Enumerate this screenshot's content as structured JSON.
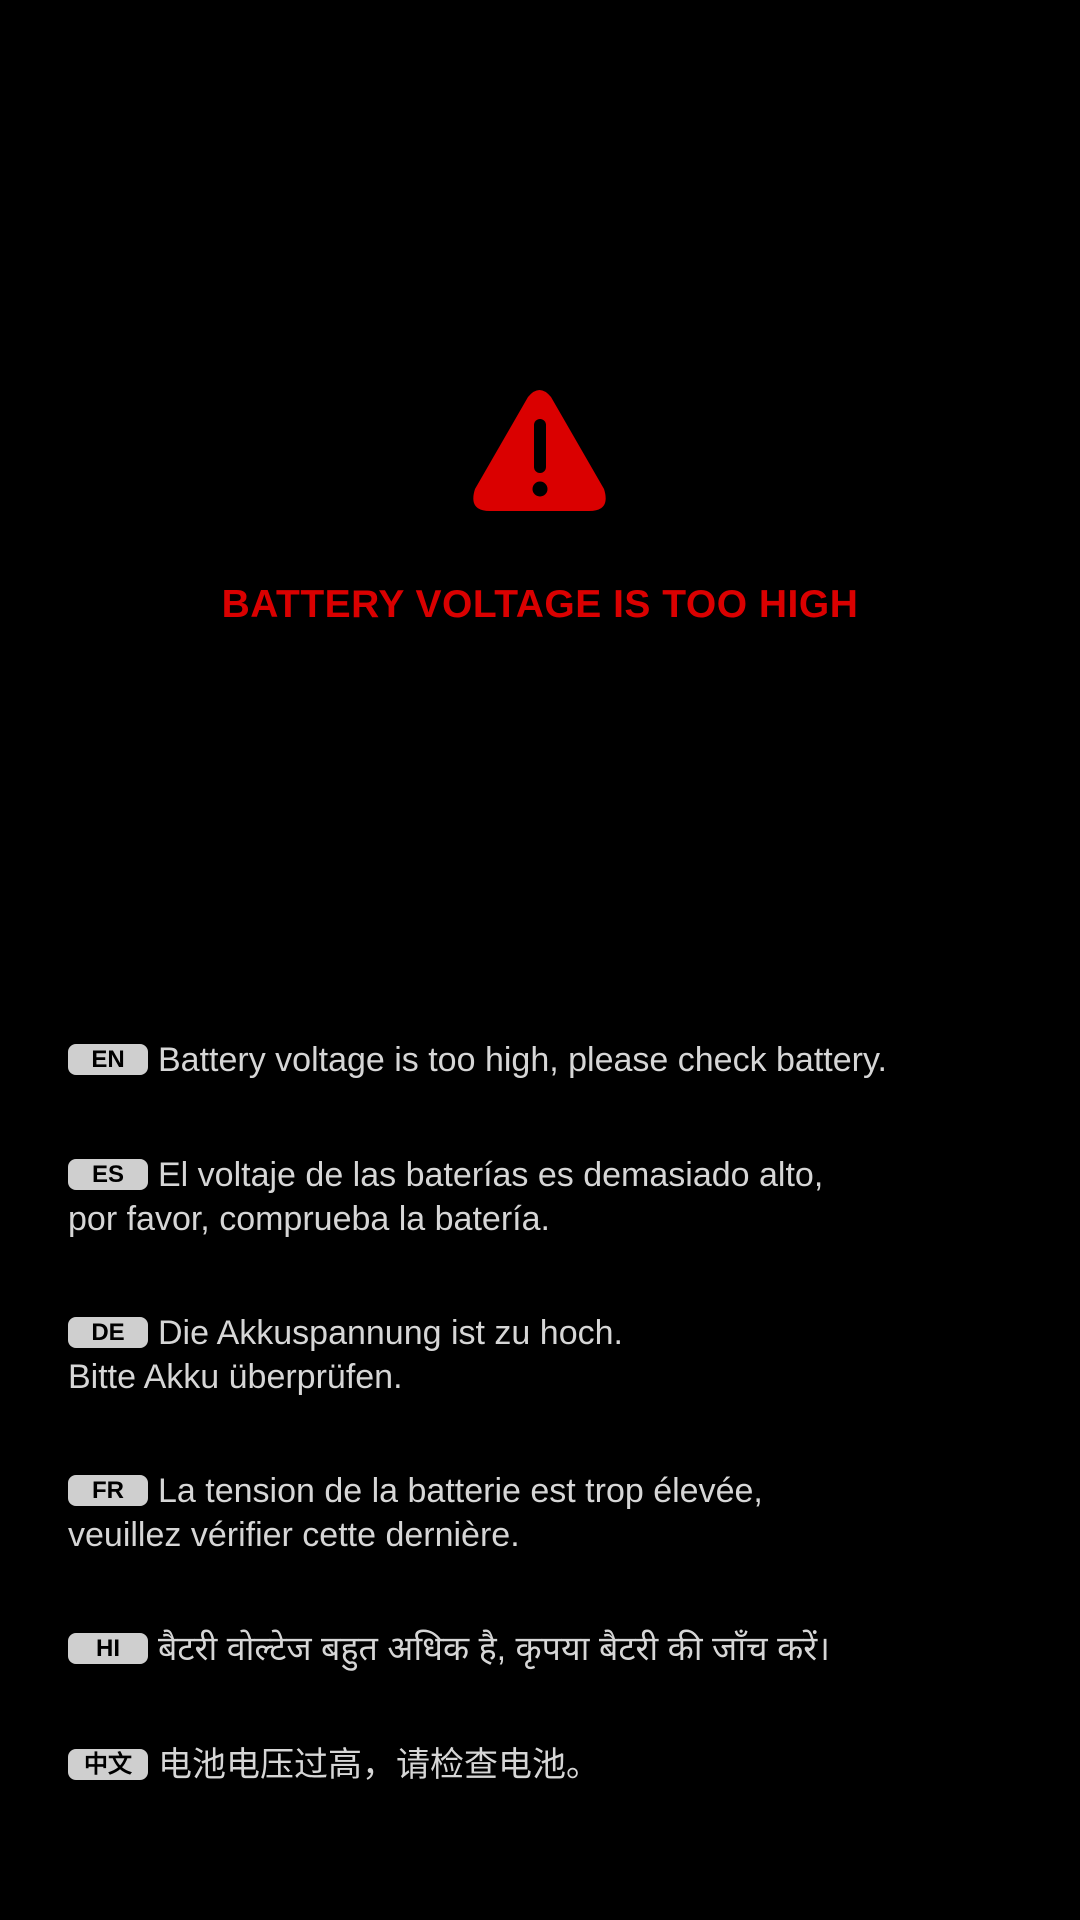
{
  "colors": {
    "background": "#000000",
    "alert_red": "#DA0000",
    "text_gray": "#D6D6D6",
    "badge_bg": "#CFCFCF",
    "badge_text": "#000000"
  },
  "icon": {
    "name": "warning-triangle-icon"
  },
  "alert": {
    "title": "BATTERY VOLTAGE IS TOO HIGH"
  },
  "messages": [
    {
      "code": "EN",
      "line1": "Battery voltage is too high, please check battery.",
      "line2": ""
    },
    {
      "code": "ES",
      "line1": "El voltaje de las baterías es demasiado alto,",
      "line2": "por favor, comprueba la batería."
    },
    {
      "code": "DE",
      "line1": "Die Akkuspannung ist zu hoch.",
      "line2": "Bitte Akku überprüfen."
    },
    {
      "code": "FR",
      "line1": "La tension de la batterie est trop élevée,",
      "line2": "veuillez vérifier cette dernière."
    },
    {
      "code": "HI",
      "line1": "बैटरी वोल्टेज बहुत अधिक है, कृपया बैटरी की जाँच करें।",
      "line2": ""
    },
    {
      "code": "中文",
      "line1": "电池电压过高，请检查电池。",
      "line2": ""
    }
  ]
}
